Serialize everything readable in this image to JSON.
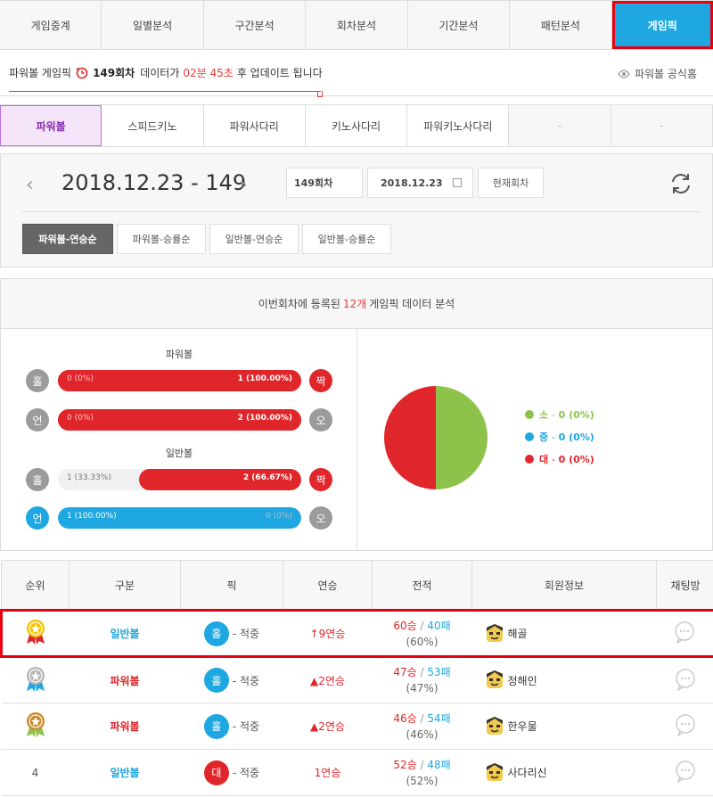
{
  "topnav": {
    "tabs": [
      "게임중계",
      "일별분석",
      "구간분석",
      "회차분석",
      "기간분석",
      "패턴분석",
      "게임픽"
    ]
  },
  "notice": {
    "prefix": "파워볼 게임픽",
    "round": "149회차",
    "mid": "데이터가",
    "time": "02분 45초",
    "suffix": "후 업데이트 됩니다",
    "official": "파워볼 공식홈"
  },
  "gametabs": [
    "파워볼",
    "스피드키노",
    "파워사다리",
    "키노사다리",
    "파워키노사다리",
    "-",
    "-"
  ],
  "datepanel": {
    "title": "2018.12.23 - 149",
    "round_field": "149회차",
    "date_field": "2018.12.23",
    "current_btn": "현재회차",
    "sort_buttons": [
      "파워볼-연승순",
      "파워볼-승률순",
      "일반볼-연승순",
      "일반볼-승률순"
    ]
  },
  "analysis": {
    "head_prefix": "이번회차에 등록된",
    "head_count": "12개",
    "head_suffix": "게임픽 데이터 분석",
    "powerball_title": "파워볼",
    "normal_title": "일반볼",
    "rows": [
      {
        "left": "홀",
        "right": "짝",
        "left_label": "0 (0%)",
        "right_label": "1 (100.00%)",
        "left_value": 0,
        "right_value": 1
      },
      {
        "left": "언",
        "right": "오",
        "left_label": "0 (0%)",
        "right_label": "2 (100.00%)",
        "left_value": 0,
        "right_value": 2
      },
      {
        "left": "홀",
        "right": "짝",
        "left_label": "1 (33.33%)",
        "right_label": "2 (66.67%)",
        "left_value": 1,
        "right_value": 2
      },
      {
        "left": "언",
        "right": "오",
        "left_label": "1 (100.00%)",
        "right_label": "0 (0%)",
        "left_value": 1,
        "right_value": 0
      }
    ],
    "legend": [
      {
        "name": "소",
        "value": "0 (0%)",
        "color": "#8dc34a"
      },
      {
        "name": "중",
        "value": "0 (0%)",
        "color": "#1ea7e0"
      },
      {
        "name": "대",
        "value": "0 (0%)",
        "color": "#e0262b"
      }
    ]
  },
  "chart_data": {
    "type": "pie",
    "categories": [
      "소",
      "중",
      "대"
    ],
    "values": [
      0,
      0,
      0
    ],
    "drawn_fractions": [
      0.5,
      0,
      0.5
    ],
    "colors": [
      "#8dc34a",
      "#1ea7e0",
      "#e0262b"
    ]
  },
  "rank": {
    "headers": [
      "순위",
      "구분",
      "픽",
      "연승",
      "전적",
      "회원정보",
      "채팅방"
    ],
    "rows": [
      {
        "rank": "",
        "medal": "gold",
        "type": "일반볼",
        "type_color": "blue",
        "pick": "홀",
        "pick_color": "#1ea7e0",
        "pick_result": "- 적중",
        "streak": "9연승",
        "streak_icon": "↑",
        "win": "60승",
        "loss": "40패",
        "pct": "(60%)",
        "member": "해골"
      },
      {
        "rank": "",
        "medal": "silver",
        "type": "파워볼",
        "type_color": "red",
        "pick": "홀",
        "pick_color": "#1ea7e0",
        "pick_result": "- 적중",
        "streak": "2연승",
        "streak_icon": "▲",
        "win": "47승",
        "loss": "53패",
        "pct": "(47%)",
        "member": "정해인"
      },
      {
        "rank": "",
        "medal": "bronze",
        "type": "파워볼",
        "type_color": "red",
        "pick": "홀",
        "pick_color": "#1ea7e0",
        "pick_result": "- 적중",
        "streak": "2연승",
        "streak_icon": "▲",
        "win": "46승",
        "loss": "54패",
        "pct": "(46%)",
        "member": "한우물"
      },
      {
        "rank": "4",
        "medal": "",
        "type": "일반볼",
        "type_color": "blue",
        "pick": "대",
        "pick_color": "#e0262b",
        "pick_result": "- 적중",
        "streak": "1연승",
        "streak_icon": "",
        "win": "52승",
        "loss": "48패",
        "pct": "(52%)",
        "member": "사다리신"
      }
    ]
  }
}
